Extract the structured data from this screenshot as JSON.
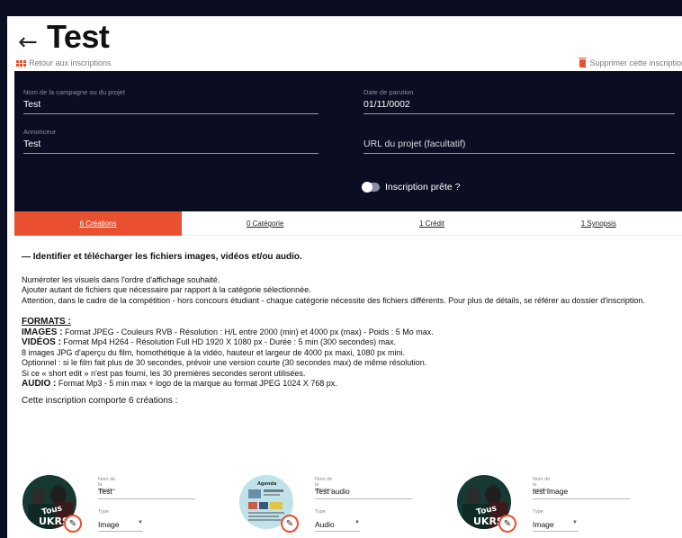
{
  "header": {
    "title": "Test",
    "back_link": "Retour aux inscriptions",
    "delete_link": "Supprimer cette inscription"
  },
  "form": {
    "campaign_label": "Nom de la campagne ou du projet",
    "campaign_value": "Test",
    "date_label": "Date de parution",
    "date_value": "01/11/0002",
    "advertiser_label": "Annonceur",
    "advertiser_value": "Test",
    "url_placeholder": "URL du projet (facultatif)",
    "ready_toggle_label": "Inscription prête ?",
    "ready_toggle_on": false
  },
  "tabs": [
    {
      "label": "6 Créations",
      "active": true
    },
    {
      "label": "0 Catégorie",
      "active": false
    },
    {
      "label": "1 Crédit",
      "active": false
    },
    {
      "label": "1 Synopsis",
      "active": false
    }
  ],
  "content": {
    "heading": "— Identifier et télécharger les fichiers images, vidéos et/ou audio.",
    "intro_line1": "Numéroter les visuels dans l'ordre d'affichage souhaité.",
    "intro_line2": "Ajouter autant de fichiers que nécessaire par rapport à la catégorie sélectionnée.",
    "intro_line3": "Attention, dans le cadre de la compétition - hors concours étudiant - chaque catégorie nécessite des fichiers différents. Pour plus de détails, se référer au dossier d'inscription.",
    "formats_title": "FORMATS :",
    "images_label": "IMAGES :",
    "images_text": "Format JPEG - Couleurs RVB - Résolution : H/L entre 2000 (min) et 4000 px (max) - Poids : 5 Mo max.",
    "videos_label": "VIDÉOS :",
    "videos_text": "Format Mp4 H264 - Résolution Full HD 1920 X 1080 px - Durée : 5 min (300 secondes) max.",
    "videos_line2": "8 images JPG d'aperçu du film, homothétique à la vidéo, hauteur et largeur de 4000 px maxi, 1080 px mini.",
    "videos_line3": "Optionnel : si le film fait plus de 30 secondes, prévoir une version courte (30 secondes max) de même résolution.",
    "videos_line4": "Si ce « short edit » n'est pas fourni, les 30 premières secondes seront utilisées.",
    "audio_label": "AUDIO :",
    "audio_text": "Format Mp3 - 5 min max + logo de la marque au format JPEG 1024 X 768 px.",
    "count_line": "Cette inscription comporte 6 créations :"
  },
  "creations": [
    {
      "name_label": "Nom de la création",
      "name": "Test",
      "type_label": "Type",
      "type": "Image",
      "thumb": "poster-image",
      "thumb_text": "Tous UKRS"
    },
    {
      "name_label": "Nom de la création",
      "name": "Test audio",
      "type_label": "Type",
      "type": "Audio",
      "thumb": "agenda-document",
      "thumb_text": "Agenda"
    },
    {
      "name_label": "Nom de la création",
      "name": "test image",
      "type_label": "Type",
      "type": "Image",
      "thumb": "poster-image",
      "thumb_text": "Tous UKRS"
    }
  ],
  "colors": {
    "accent": "#e8502f",
    "panel": "#0b0e22"
  }
}
